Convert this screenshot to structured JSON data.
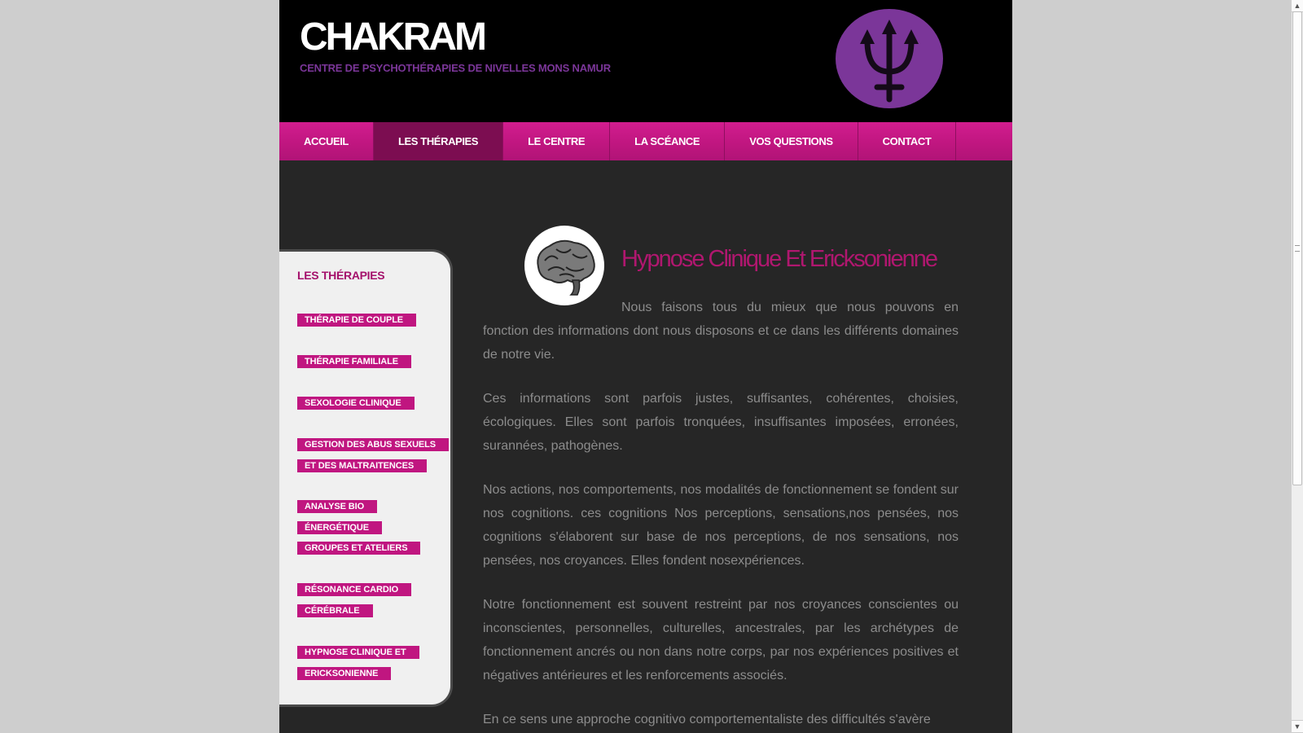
{
  "header": {
    "title": "CHAKRAM",
    "subtitle": "CENTRE DE PSYCHOTHÉRAPIES DE NIVELLES MONS NAMUR"
  },
  "colors": {
    "accent": "#c01680",
    "nav_active": "#7c0d51",
    "logo": "#7b3699",
    "header_bg": "#000000",
    "page_bg": "#262626"
  },
  "nav": {
    "items": [
      {
        "label": "ACCUEIL"
      },
      {
        "label": "LES THÉRAPIES",
        "active": true
      },
      {
        "label": "LE CENTRE"
      },
      {
        "label": "LA SCÉANCE"
      },
      {
        "label": "VOS QUESTIONS"
      },
      {
        "label": "CONTACT"
      }
    ]
  },
  "sidebar": {
    "title": "LES THÉRAPIES",
    "links": [
      {
        "label": "THÉRAPIE DE COUPLE"
      },
      {
        "label": "THÉRAPIE FAMILIALE"
      },
      {
        "label": "SEXOLOGIE CLINIQUE"
      },
      {
        "label": "GESTION DES ABUS SEXUELS ET DES MALTRAITENCES"
      },
      {
        "label": "ANALYSE BIO ÉNERGÉTIQUE"
      },
      {
        "label": "GROUPES ET ATELIERS"
      },
      {
        "label": "RÉSONANCE CARDIO CÉRÉBRALE"
      },
      {
        "label": "HYPNOSE CLINIQUE ET ERICKSONIENNE"
      }
    ]
  },
  "article": {
    "title": "Hypnose Clinique Et Ericksonienne",
    "paragraphs": [
      "Nous faisons tous du mieux que nous pouvons en fonction des informations dont nous disposons et ce dans les différents domaines de notre vie.",
      "Ces informations sont parfois justes, suffisantes, cohérentes, choisies, écologiques. Elles sont parfois tronquées, insuffisantes imposées, erronées, surannées, pathogènes.",
      "Nos actions, nos comportements, nos modalités de fonctionnement se fondent sur nos cognitions. ces cognitions Nos perceptions, sensations,nos pensées, nos cognitions s'élaborent sur base de nos perceptions, de nos sensations, nos pensées, nos croyances. Elles fondent nosexpériences.",
      "Notre fonctionnement est souvent restreint par nos croyances conscientes ou inconscientes, personnelles, culturelles, ancestrales, par les archétypes de fonctionnement ancrés ou non dans notre corps, par nos expériences positives et négatives antérieures et les renforcements associés.",
      "En ce sens une approche cognitivo comportementaliste des difficultés s'avère"
    ]
  },
  "icons": {
    "logo": "neptune-trident-icon",
    "article": "brain-icon"
  }
}
